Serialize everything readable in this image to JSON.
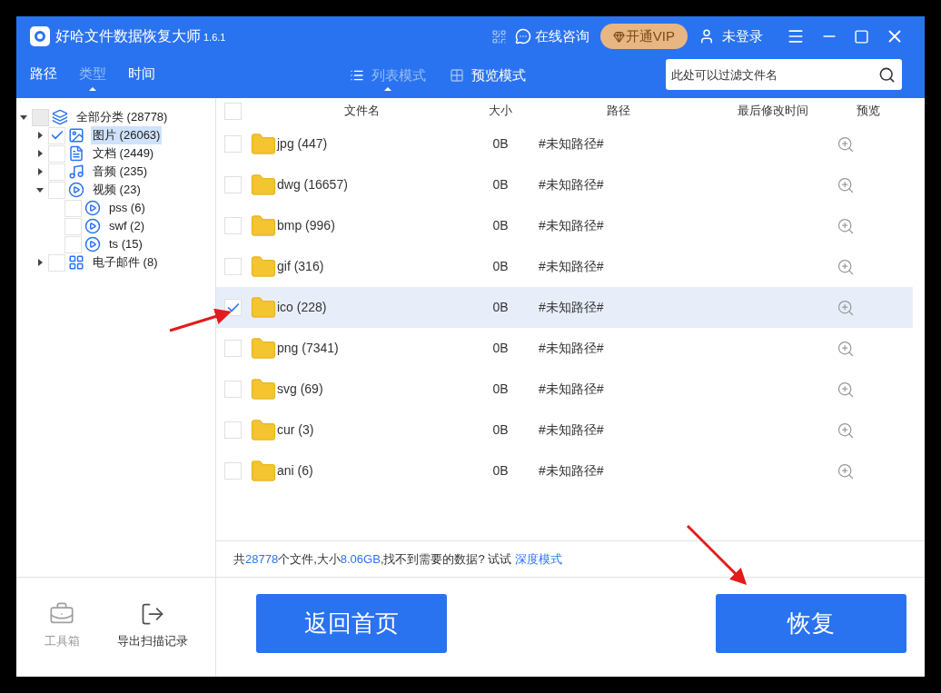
{
  "app": {
    "title": "好哈文件数据恢复大师",
    "version": "1.6.1"
  },
  "header_actions": {
    "consult": "在线咨询",
    "vip": "开通VIP",
    "login": "未登录"
  },
  "nav_tabs": [
    {
      "label": "路径",
      "selected": false
    },
    {
      "label": "类型",
      "selected": true
    },
    {
      "label": "时间",
      "selected": false
    }
  ],
  "view_modes": [
    {
      "label": "列表模式",
      "kind": "list",
      "selected": true
    },
    {
      "label": "预览模式",
      "kind": "grid",
      "selected": false
    }
  ],
  "filter": {
    "placeholder": "此处可以过滤文件名"
  },
  "tree": [
    {
      "label": "全部分类 (28778)",
      "kind": "layers",
      "checked": false,
      "selected": false,
      "expanded": true,
      "children": [
        {
          "label": "图片 (26063)",
          "kind": "image",
          "checked": true,
          "selected": true,
          "expanded": false
        },
        {
          "label": "文档 (2449)",
          "kind": "doc",
          "checked": false,
          "selected": false,
          "expanded": false
        },
        {
          "label": "音频 (235)",
          "kind": "audio",
          "checked": false,
          "selected": false,
          "expanded": false
        },
        {
          "label": "视频 (23)",
          "kind": "video",
          "checked": false,
          "selected": false,
          "expanded": true,
          "children": [
            {
              "label": "pss (6)",
              "kind": "video",
              "checked": false,
              "selected": false
            },
            {
              "label": "swf (2)",
              "kind": "video",
              "checked": false,
              "selected": false
            },
            {
              "label": "ts (15)",
              "kind": "video",
              "checked": false,
              "selected": false
            }
          ]
        },
        {
          "label": "电子邮件 (8)",
          "kind": "grid",
          "checked": false,
          "selected": false,
          "expanded": false
        }
      ]
    }
  ],
  "tools": [
    {
      "label": "工具箱",
      "kind": "toolbox",
      "disabled": true
    },
    {
      "label": "导出扫描记录",
      "kind": "export",
      "disabled": false
    }
  ],
  "table": {
    "select_all": {
      "checked": false
    },
    "columns": [
      "文件名",
      "大小",
      "路径",
      "最后修改时间",
      "预览"
    ],
    "rows": [
      {
        "name": "jpg (447)",
        "size": "0B",
        "path": "#未知路径#",
        "checked": false,
        "selected": false
      },
      {
        "name": "dwg (16657)",
        "size": "0B",
        "path": "#未知路径#",
        "checked": false,
        "selected": false
      },
      {
        "name": "bmp (996)",
        "size": "0B",
        "path": "#未知路径#",
        "checked": false,
        "selected": false
      },
      {
        "name": "gif (316)",
        "size": "0B",
        "path": "#未知路径#",
        "checked": false,
        "selected": false
      },
      {
        "name": "ico (228)",
        "size": "0B",
        "path": "#未知路径#",
        "checked": true,
        "selected": true
      },
      {
        "name": "png (7341)",
        "size": "0B",
        "path": "#未知路径#",
        "checked": false,
        "selected": false
      },
      {
        "name": "svg (69)",
        "size": "0B",
        "path": "#未知路径#",
        "checked": false,
        "selected": false
      },
      {
        "name": "cur (3)",
        "size": "0B",
        "path": "#未知路径#",
        "checked": false,
        "selected": false
      },
      {
        "name": "ani (6)",
        "size": "0B",
        "path": "#未知路径#",
        "checked": false,
        "selected": false
      }
    ]
  },
  "summary": [
    {
      "text": "共",
      "kind": "text"
    },
    {
      "text": "28778",
      "kind": "number"
    },
    {
      "text": "个文件,大小",
      "kind": "text"
    },
    {
      "text": "8.06GB",
      "kind": "number"
    },
    {
      "text": ",找不到需要的数据? 试试 ",
      "kind": "text"
    },
    {
      "text": "深度模式",
      "kind": "link"
    }
  ],
  "buttons": [
    {
      "label": "返回首页"
    },
    {
      "label": "恢复"
    }
  ]
}
